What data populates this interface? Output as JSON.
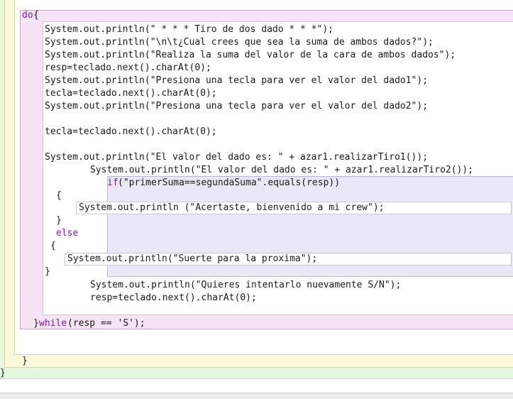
{
  "editor": {
    "do_keyword": "do",
    "do_brace": "{",
    "lines": [
      "System.out.println(\" * * * Tiro de dos dado * * *\");",
      "System.out.println(\"\\n\\t¿Cual crees que sea la suma de ambos dados?\");",
      "System.out.println(\"Realiza la suma del valor de la cara de ambos dados\");",
      "resp=teclado.next().charAt(0);",
      "System.out.println(\"Presiona una tecla para ver el valor del dado1\");",
      "tecla=teclado.next().charAt(0);",
      "System.out.println(\"Presiona una tecla para ver el valor del dado2\");",
      "tecla=teclado.next().charAt(0);",
      "System.out.println(\"El valor del dado es: \" + azar1.realizarTiro1());",
      "System.out.println(\"El valor del dado es: \" + azar1.realizarTiro2());"
    ],
    "if_keyword": "if",
    "if_condition": "(\"primerSuma==segundaSuma\".equals(resp))",
    "open_brace_1": "{",
    "success_stmt": "System.out.println (\"Acertaste, bienvenido a mi crew\");",
    "close_brace_1": "}",
    "else_keyword": "else",
    "open_brace_2": "{",
    "fail_stmt": "System.out.println(\"Suerte para la proxima\");",
    "close_brace_2": "}",
    "after_lines": [
      "System.out.println(\"Quieres intentarlo nuevamente S/N\");",
      "resp=teclado.next().charAt(0);"
    ],
    "while_close": "}",
    "while_keyword": "while",
    "while_condition": "(resp == 'S');",
    "method_close": "}",
    "class_close": "}"
  }
}
